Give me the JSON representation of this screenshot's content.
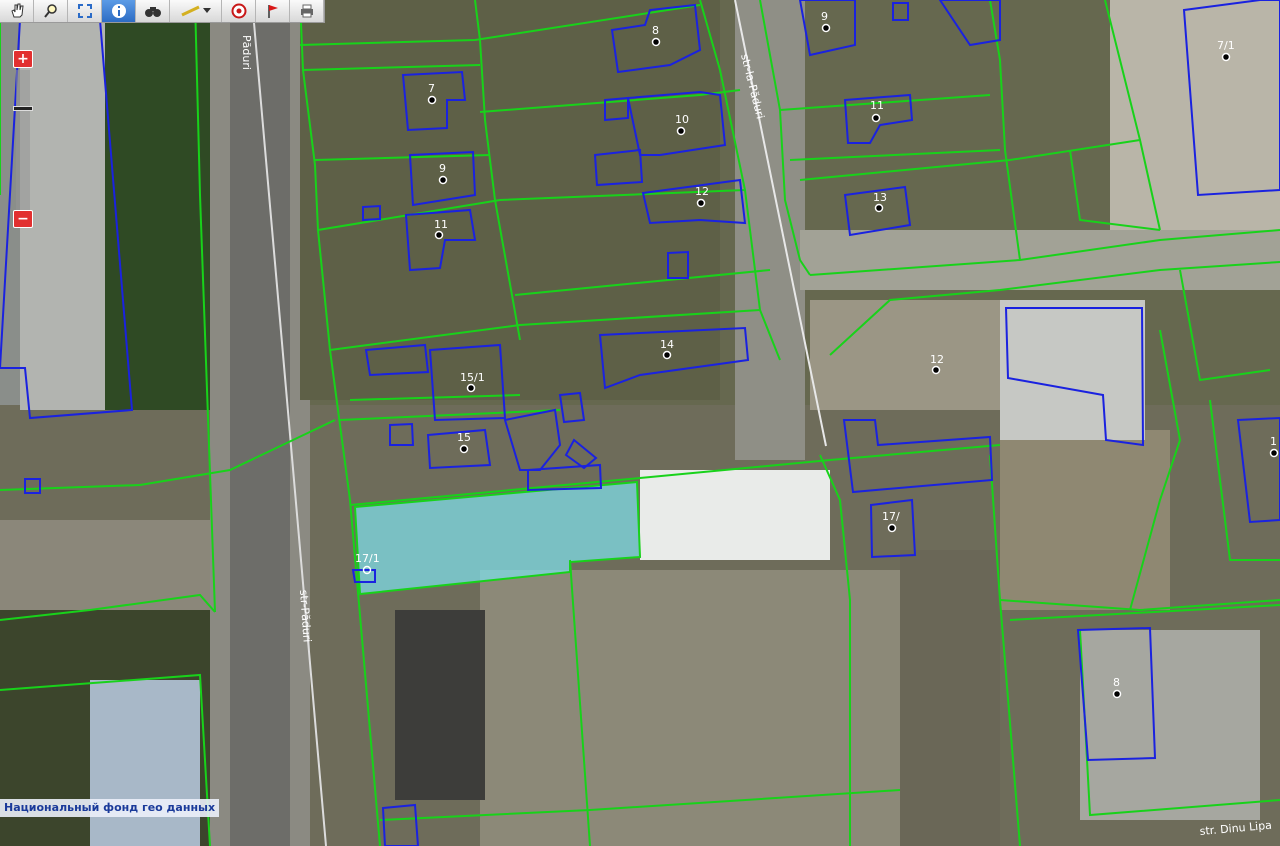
{
  "toolbar": {
    "tools": [
      "pan-tool",
      "zoom-tool",
      "zoom-extent-tool",
      "info-tool",
      "find-tool",
      "measure-tool",
      "identify-tool",
      "flag-tool",
      "print-tool"
    ],
    "active": "info-tool"
  },
  "zoom": {
    "plus": "+",
    "minus": "−",
    "level_fraction": 0.27
  },
  "attribution": "Национальный фонд гео данных",
  "parcels": [
    "8",
    "9",
    "7",
    "10",
    "11",
    "9",
    "12",
    "13",
    "11",
    "14",
    "12",
    "15/1",
    "15",
    "17/1",
    "17/",
    "7/1",
    "8",
    "1"
  ],
  "streets": [
    "Păduri",
    "str-la-Păduri",
    "str-Păduri",
    "str. Dinu Lipa"
  ],
  "colors": {
    "parcel_boundary": "#18d21a",
    "building_outline": "#1a22e0",
    "selected_fill": "#7fe0ec",
    "road": "#8c8c84"
  }
}
